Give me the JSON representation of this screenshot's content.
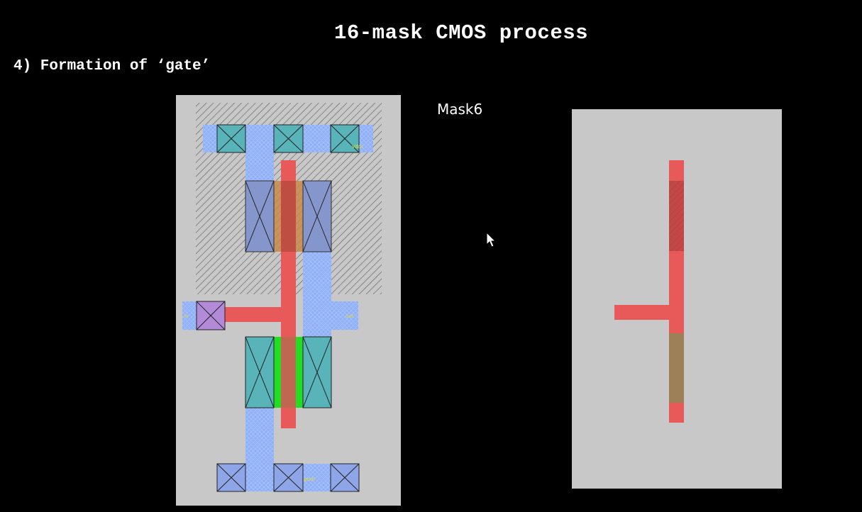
{
  "slide": {
    "title": "16-mask CMOS process",
    "subtitle": "4) Formation of ‘gate’",
    "mask_label": "Mask6"
  },
  "layout_labels": {
    "supply": "vdd!",
    "input": "in",
    "output": "out",
    "ground": "gnd!"
  },
  "colors": {
    "background": "#000000",
    "panel": "#c8c8c8",
    "poly": "#e85a5a",
    "metal": "#8fb0f8",
    "contact": "#8ea6e8",
    "pdiff": "#c98a4a",
    "ndiff_contact": "#58b4b8",
    "nwell_hatch": "#555555",
    "select_green": "#22dd22",
    "label_yellow": "#dddd33"
  },
  "icons": {
    "cursor": "mouse-pointer-icon"
  }
}
